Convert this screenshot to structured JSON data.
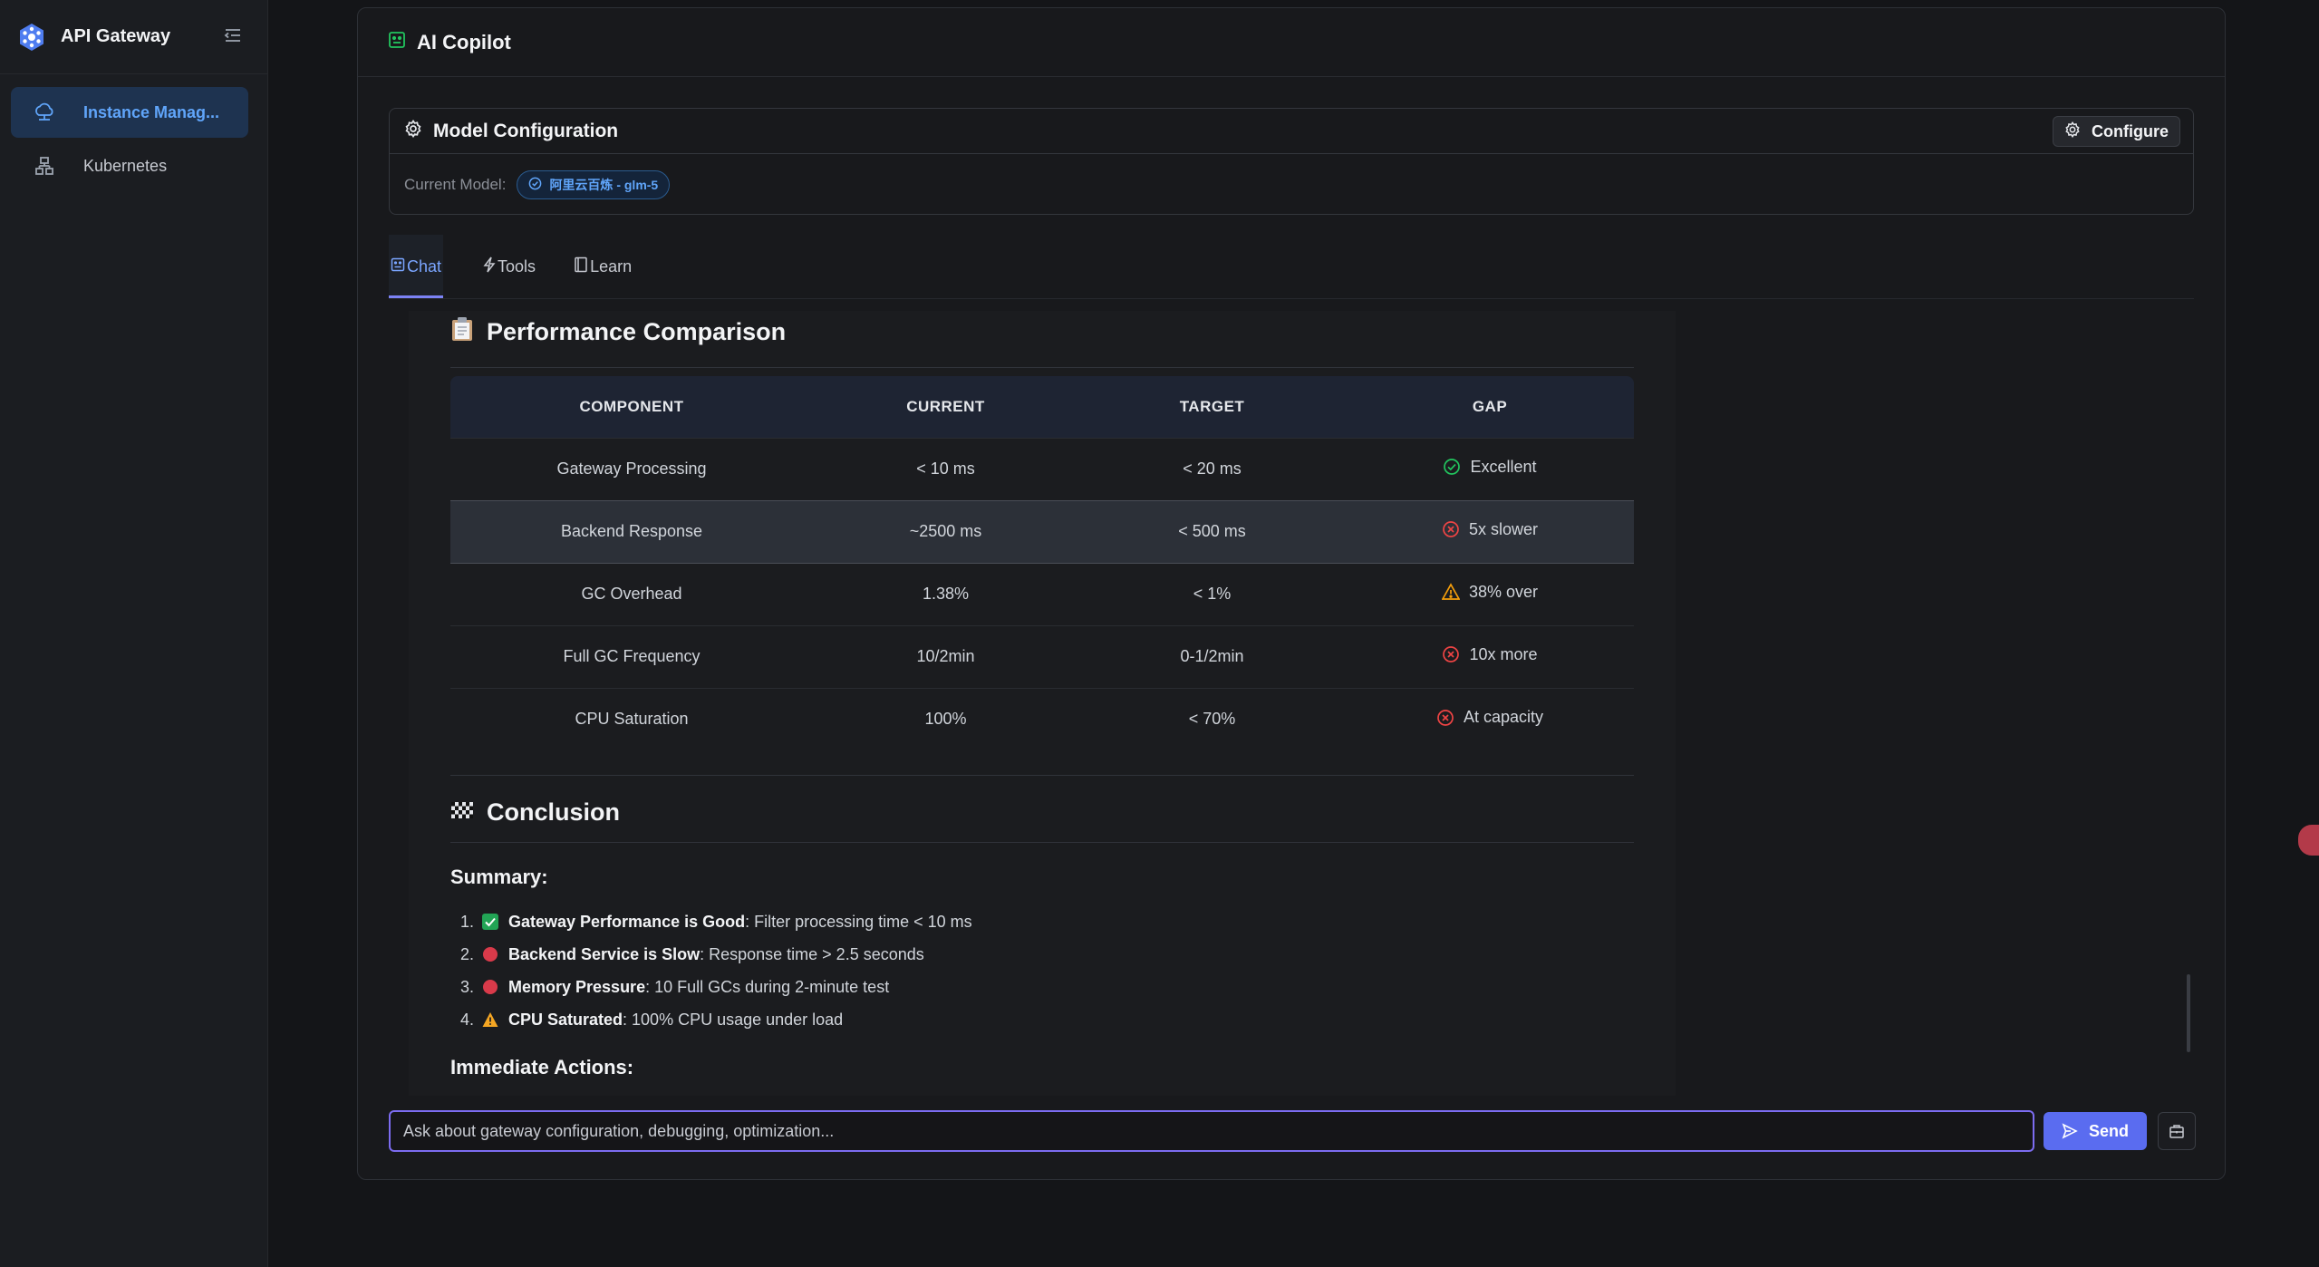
{
  "app": {
    "name": "API Gateway"
  },
  "sidebar": {
    "items": [
      {
        "label": "Instance Manag...",
        "icon": "cloud-network-icon",
        "active": true
      },
      {
        "label": "Kubernetes",
        "icon": "cluster-icon",
        "active": false
      }
    ]
  },
  "panel": {
    "title": "AI Copilot"
  },
  "model_config": {
    "title": "Model Configuration",
    "configure_label": "Configure",
    "current_model_label": "Current Model:",
    "current_model_value": "阿里云百炼 - glm-5"
  },
  "tabs": [
    {
      "label": "Chat",
      "active": true
    },
    {
      "label": "Tools",
      "active": false
    },
    {
      "label": "Learn",
      "active": false
    }
  ],
  "performance": {
    "title": "Performance Comparison",
    "columns": [
      "COMPONENT",
      "CURRENT",
      "TARGET",
      "GAP"
    ],
    "rows": [
      {
        "component": "Gateway Processing",
        "current": "< 10 ms",
        "target": "< 20 ms",
        "gap": "Excellent",
        "status": "ok"
      },
      {
        "component": "Backend Response",
        "current": "~2500 ms",
        "target": "< 500 ms",
        "gap": "5x slower",
        "status": "bad"
      },
      {
        "component": "GC Overhead",
        "current": "1.38%",
        "target": "< 1%",
        "gap": "38% over",
        "status": "warn"
      },
      {
        "component": "Full GC Frequency",
        "current": "10/2min",
        "target": "0-1/2min",
        "gap": "10x more",
        "status": "bad"
      },
      {
        "component": "CPU Saturation",
        "current": "100%",
        "target": "< 70%",
        "gap": "At capacity",
        "status": "bad"
      }
    ]
  },
  "conclusion": {
    "title": "Conclusion",
    "summary_heading": "Summary:",
    "items": [
      {
        "num": "1.",
        "emoji": "check",
        "bold": "Gateway Performance is Good",
        "text": ": Filter processing time < 10 ms"
      },
      {
        "num": "2.",
        "emoji": "red-circle",
        "bold": "Backend Service is Slow",
        "text": ": Response time > 2.5 seconds"
      },
      {
        "num": "3.",
        "emoji": "red-circle",
        "bold": "Memory Pressure",
        "text": ": 10 Full GCs during 2-minute test"
      },
      {
        "num": "4.",
        "emoji": "warning",
        "bold": "CPU Saturated",
        "text": ": 100% CPU usage under load"
      }
    ],
    "actions_heading": "Immediate Actions:"
  },
  "input": {
    "placeholder": "Ask about gateway configuration, debugging, optimization...",
    "send_label": "Send"
  },
  "colors": {
    "accent": "#5a6cf0",
    "ok": "#22c55e",
    "bad": "#ef4444",
    "warn": "#f59e0b",
    "link": "#60a5fa"
  }
}
